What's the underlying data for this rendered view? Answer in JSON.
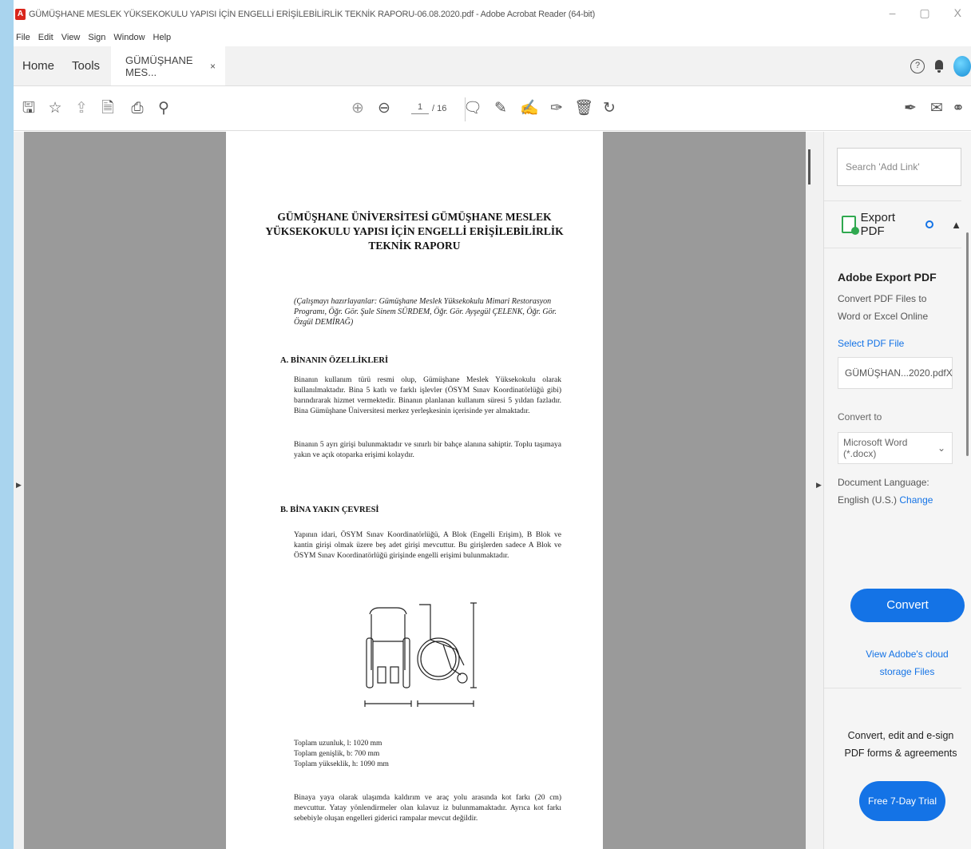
{
  "window": {
    "title": "GÜMÜŞHANE MESLEK YÜKSEKOKULU YAPISI İÇİN ENGELLİ ERİŞİLEBİLİRLİK TEKNİK RAPORU-06.08.2020.pdf - Adobe Acrobat Reader (64-bit)",
    "minimize": "–",
    "restore": "▢",
    "close": "X"
  },
  "menu": [
    "File",
    "Edit",
    "View",
    "Sign",
    "Window",
    "Help"
  ],
  "tabs": {
    "home": "Home",
    "tools": "Tools",
    "document": "GÜMÜŞHANE MES...",
    "document_close": "×"
  },
  "toolbar": {
    "current_page": "1",
    "total_pages": "/ 16"
  },
  "document": {
    "title": "GÜMÜŞHANE ÜNİVERSİTESİ GÜMÜŞHANE MESLEK YÜKSEKOKULU YAPISI İÇİN ENGELLİ ERİŞİLEBİLİRLİK TEKNİK RAPORU",
    "authors": "(Çalışmayı hazırlayanlar: Gümüşhane Meslek Yüksekokulu Mimari Restorasyon Programı, Öğr. Gör. Şule Sinem SÜRDEM, Öğr. Gör. Ayşegül ÇELENK, Öğr. Gör. Özgül DEMİRAĞ)",
    "section_a": "A. BİNANIN ÖZELLİKLERİ",
    "para_a1": "Binanın kullanım türü resmi olup, Gümüşhane Meslek Yüksekokulu olarak kullanılmaktadır. Bina 5 katlı ve farklı işlevler (ÖSYM Sınav Koordinatörlüğü gibi) barındırarak hizmet vermektedir. Binanın planlanan kullanım süresi 5 yıldan fazladır. Bina Gümüşhane Üniversitesi merkez yerleşkesinin içerisinde yer almaktadır.",
    "para_a2": "Binanın 5 ayrı girişi bulunmaktadır ve sınırlı bir bahçe alanına sahiptir. Toplu taşımaya yakın ve açık otoparka erişimi kolaydır.",
    "section_b": "B. BİNA YAKIN ÇEVRESİ",
    "para_b1": "Yapının idari, ÖSYM Sınav Koordinatörlüğü, A Blok (Engelli Erişim), B Blok ve kantin girişi olmak üzere beş adet girişi mevcuttur. Bu girişlerden sadece A Blok ve ÖSYM Sınav Koordinatörlüğü girişinde engelli erişimi bulunmaktadır.",
    "dims": {
      "length": "Toplam uzunluk, l: 1020 mm",
      "width": "Toplam genişlik, b: 700 mm",
      "height": "Toplam yükseklik, h: 1090 mm"
    },
    "para_b2": "Binaya yaya olarak ulaşımda kaldırım ve araç yolu arasında kot farkı (20 cm) mevcuttur. Yatay yönlendirmeler olan kılavuz iz bulunmamaktadır. Ayrıca kot farkı sebebiyle oluşan engelleri giderici rampalar mevcut değildir."
  },
  "right_panel": {
    "search_placeholder": "Search 'Add Link'",
    "export_label": "Export PDF",
    "panel_title": "Adobe Export PDF",
    "description": "Convert PDF Files to Word or Excel Online",
    "select_file_label": "Select PDF File",
    "file_name": "GÜMÜŞHAN...2020.pdf",
    "file_remove": "X",
    "convert_to_label": "Convert to",
    "convert_to_value": "Microsoft Word (*.docx)",
    "doc_language_label": "Document Language:",
    "doc_language_value": "English (U.S.)",
    "change_link": "Change",
    "convert_button": "Convert",
    "cloud_link": "View Adobe's cloud storage Files",
    "promo_text": "Convert, edit and e-sign PDF forms & agreements",
    "trial_button": "Free 7-Day Trial"
  },
  "colors": {
    "accent": "#1473e6",
    "doc_background": "#9a9a9a",
    "export_icon": "#2fa84f"
  }
}
